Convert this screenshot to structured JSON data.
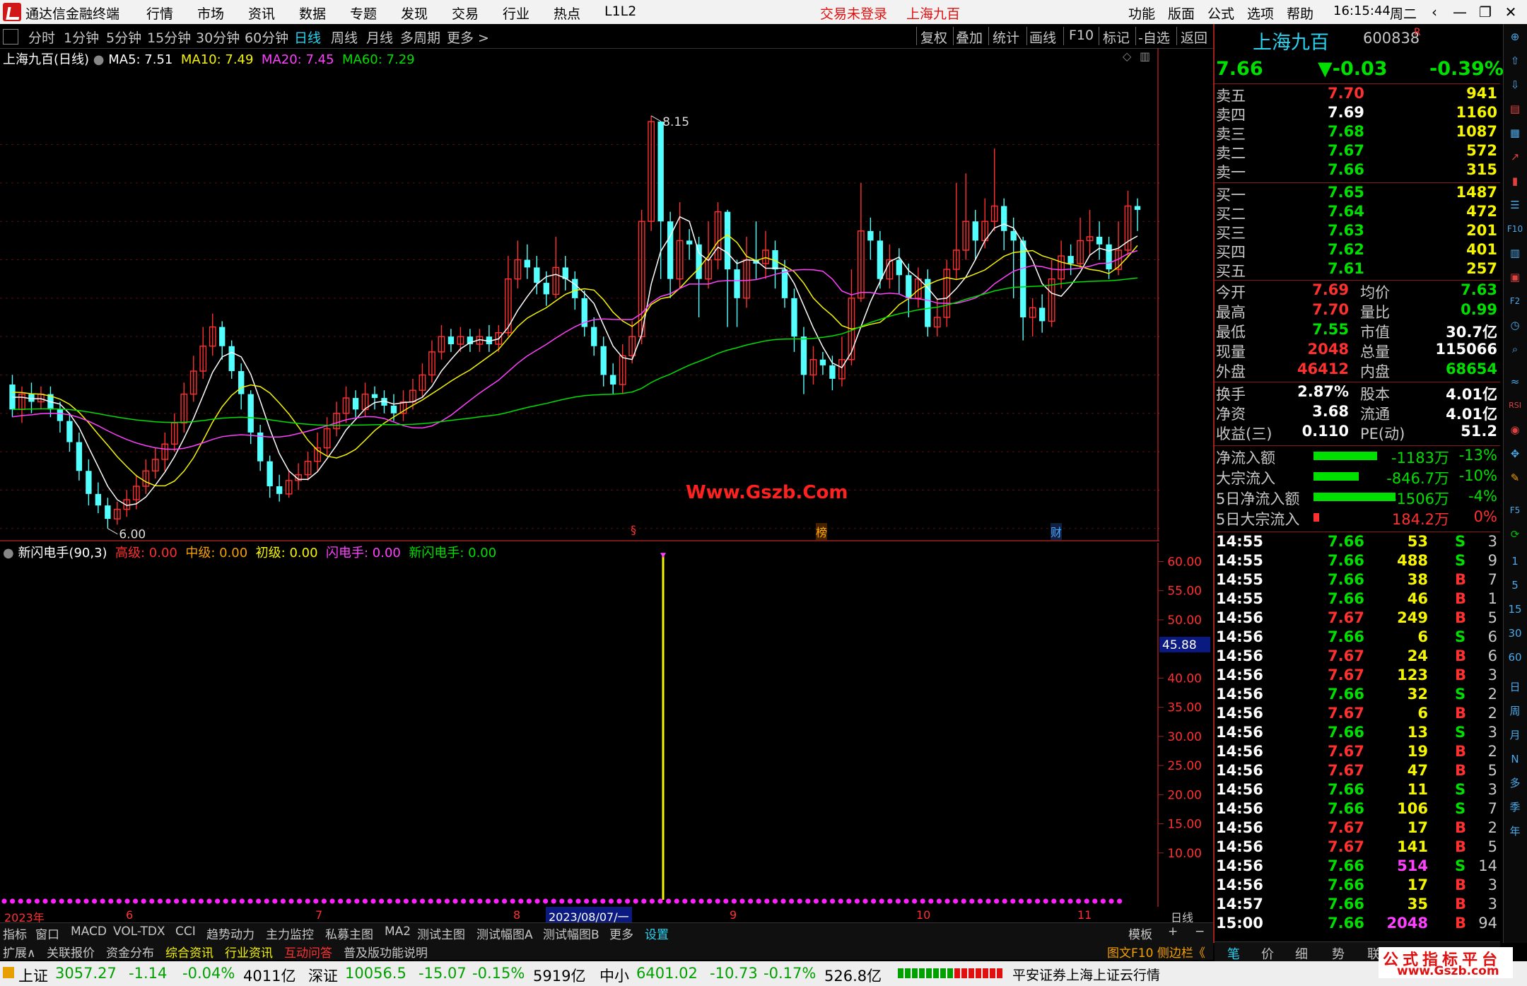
{
  "app": {
    "title": "通达信金融终端",
    "menu": [
      "行情",
      "市场",
      "资讯",
      "数据",
      "专题",
      "发现",
      "交易",
      "行业",
      "热点",
      "L1L2"
    ],
    "login_status": "交易未登录",
    "stock_name_title": "上海九百",
    "right_menu": [
      "功能",
      "版面",
      "公式",
      "选项",
      "帮助"
    ],
    "clock": "16:15:44",
    "weekday": "周二"
  },
  "toolbar": {
    "periods": [
      "分时",
      "1分钟",
      "5分钟",
      "15分钟",
      "30分钟",
      "60分钟",
      "日线",
      "周线",
      "月线",
      "多周期",
      "更多 >"
    ],
    "active_period": "日线",
    "actions": [
      "复权",
      "叠加",
      "统计",
      "画线",
      "F10",
      "标记",
      "-自选",
      "返回"
    ]
  },
  "main_chart": {
    "header_name": "上海九百(日线)",
    "ma": [
      {
        "label": "MA5: 7.51",
        "color": "#ffffff"
      },
      {
        "label": "MA10: 7.49",
        "color": "#f5f500"
      },
      {
        "label": "MA20: 7.45",
        "color": "#ff40ff"
      },
      {
        "label": "MA60: 7.29",
        "color": "#00e000"
      }
    ],
    "y_ticks": [
      "8.00",
      "7.80",
      "7.60",
      "7.40",
      "7.20",
      "7.00",
      "6.80",
      "6.60",
      "6.40",
      "6.20",
      "6.00"
    ],
    "high_label": "8.15",
    "low_label": "6.00",
    "watermark": "Www.Gszb.Com",
    "markers": [
      "§",
      "榜",
      "财"
    ]
  },
  "indicator": {
    "header": "新闪电手(90,3)",
    "items": [
      {
        "label": "高级: 0.00",
        "color": "#ff3030"
      },
      {
        "label": "中级: 0.00",
        "color": "#f5a000"
      },
      {
        "label": "初级: 0.00",
        "color": "#f5f500"
      },
      {
        "label": "闪电手: 0.00",
        "color": "#ff40ff"
      },
      {
        "label": "新闪电手: 0.00",
        "color": "#00e000"
      }
    ],
    "y_ticks": [
      "60.00",
      "55.00",
      "50.00",
      "40.00",
      "35.00",
      "30.00",
      "25.00",
      "20.00",
      "15.00",
      "10.00"
    ],
    "cursor_value": "45.88"
  },
  "x_axis": {
    "labels": [
      "2023年",
      "6",
      "7",
      "8",
      "9",
      "10",
      "11"
    ],
    "cursor_date": "2023/08/07/一",
    "period_label": "日线"
  },
  "tabs_row1": [
    "指标",
    "窗口",
    "MACD",
    "VOL-TDX",
    "CCI",
    "趋势动力",
    "主力监控",
    "私募主图",
    "MA2",
    "测试主图",
    "测试幅图A",
    "测试幅图B",
    "更多",
    "设置"
  ],
  "tabs_row1_right": [
    "模板",
    "+",
    "−"
  ],
  "tabs_row2": [
    "扩展∧",
    "关联报价",
    "资金分布",
    "综合资讯",
    "行业资讯",
    "互动问答",
    "普及版功能说明"
  ],
  "tabs_row2_right": "图文F10 侧边栏《",
  "quote": {
    "name": "上海九百",
    "code": "600838",
    "flag": "R",
    "price": "7.66",
    "change": "▼-0.03",
    "pct": "-0.39%",
    "asks": [
      {
        "label": "卖五",
        "price": "7.70",
        "vol": "941"
      },
      {
        "label": "卖四",
        "price": "7.69",
        "vol": "1160"
      },
      {
        "label": "卖三",
        "price": "7.68",
        "vol": "1087"
      },
      {
        "label": "卖二",
        "price": "7.67",
        "vol": "572"
      },
      {
        "label": "卖一",
        "price": "7.66",
        "vol": "315"
      }
    ],
    "bids": [
      {
        "label": "买一",
        "price": "7.65",
        "vol": "1487"
      },
      {
        "label": "买二",
        "price": "7.64",
        "vol": "472"
      },
      {
        "label": "买三",
        "price": "7.63",
        "vol": "201"
      },
      {
        "label": "买四",
        "price": "7.62",
        "vol": "401"
      },
      {
        "label": "买五",
        "price": "7.61",
        "vol": "257"
      }
    ],
    "stats": [
      {
        "l1": "今开",
        "v1": "7.69",
        "l2": "均价",
        "v2": "7.63"
      },
      {
        "l1": "最高",
        "v1": "7.70",
        "l2": "量比",
        "v2": "0.99"
      },
      {
        "l1": "最低",
        "v1": "7.55",
        "l2": "市值",
        "v2": "30.7亿"
      },
      {
        "l1": "现量",
        "v1": "2048",
        "l2": "总量",
        "v2": "115066"
      },
      {
        "l1": "外盘",
        "v1": "46412",
        "l2": "内盘",
        "v2": "68654"
      }
    ],
    "stats2": [
      {
        "l1": "换手",
        "v1": "2.87%",
        "l2": "股本",
        "v2": "4.01亿"
      },
      {
        "l1": "净资",
        "v1": "3.68",
        "l2": "流通",
        "v2": "4.01亿"
      },
      {
        "l1": "收益(三)",
        "v1": "0.110",
        "l2": "PE(动)",
        "v2": "51.2"
      }
    ],
    "flows": [
      {
        "label": "净流入额",
        "value": "-1183万",
        "pct": "-13%",
        "bar": 0.45,
        "color": "#00e000"
      },
      {
        "label": "大宗流入",
        "value": "-846.7万",
        "pct": "-10%",
        "bar": 0.32,
        "color": "#00e000"
      },
      {
        "label": "5日净流入额",
        "value": "-1506万",
        "pct": "-4%",
        "bar": 0.58,
        "color": "#00e000"
      },
      {
        "label": "5日大宗流入",
        "value": "184.2万",
        "pct": "0%",
        "bar": 0.04,
        "color": "#ff3030"
      }
    ]
  },
  "ticks": [
    {
      "t": "14:55",
      "p": "7.66",
      "v": "53",
      "s": "S",
      "n": "3"
    },
    {
      "t": "14:55",
      "p": "7.66",
      "v": "488",
      "s": "S",
      "n": "9"
    },
    {
      "t": "14:55",
      "p": "7.66",
      "v": "38",
      "s": "B",
      "n": "7"
    },
    {
      "t": "14:55",
      "p": "7.66",
      "v": "46",
      "s": "B",
      "n": "1"
    },
    {
      "t": "14:56",
      "p": "7.67",
      "v": "249",
      "s": "B",
      "n": "5"
    },
    {
      "t": "14:56",
      "p": "7.66",
      "v": "6",
      "s": "S",
      "n": "6"
    },
    {
      "t": "14:56",
      "p": "7.67",
      "v": "24",
      "s": "B",
      "n": "6"
    },
    {
      "t": "14:56",
      "p": "7.67",
      "v": "123",
      "s": "B",
      "n": "3"
    },
    {
      "t": "14:56",
      "p": "7.66",
      "v": "32",
      "s": "S",
      "n": "2"
    },
    {
      "t": "14:56",
      "p": "7.67",
      "v": "6",
      "s": "B",
      "n": "2"
    },
    {
      "t": "14:56",
      "p": "7.66",
      "v": "13",
      "s": "S",
      "n": "3"
    },
    {
      "t": "14:56",
      "p": "7.67",
      "v": "19",
      "s": "B",
      "n": "2"
    },
    {
      "t": "14:56",
      "p": "7.67",
      "v": "47",
      "s": "B",
      "n": "5"
    },
    {
      "t": "14:56",
      "p": "7.66",
      "v": "11",
      "s": "S",
      "n": "3"
    },
    {
      "t": "14:56",
      "p": "7.66",
      "v": "106",
      "s": "S",
      "n": "7"
    },
    {
      "t": "14:56",
      "p": "7.67",
      "v": "17",
      "s": "B",
      "n": "2"
    },
    {
      "t": "14:56",
      "p": "7.67",
      "v": "141",
      "s": "B",
      "n": "5"
    },
    {
      "t": "14:56",
      "p": "7.66",
      "v": "514",
      "s": "S",
      "n": "14"
    },
    {
      "t": "14:56",
      "p": "7.66",
      "v": "17",
      "s": "B",
      "n": "3"
    },
    {
      "t": "14:57",
      "p": "7.66",
      "v": "35",
      "s": "B",
      "n": "3"
    },
    {
      "t": "15:00",
      "p": "7.66",
      "v": "2048",
      "s": "B",
      "n": "94"
    }
  ],
  "panel_tabs": [
    "笔",
    "价",
    "细",
    "势",
    "联"
  ],
  "sidebar_labels": [
    "1",
    "5",
    "15",
    "30",
    "60",
    "日",
    "周",
    "月",
    "N",
    "多",
    "季",
    "年"
  ],
  "status": {
    "indices": [
      {
        "name": "上证",
        "val": "3057.27",
        "chg": "-1.14",
        "pct": "-0.04%",
        "amt": "4011亿"
      },
      {
        "name": "深证",
        "val": "10056.5",
        "chg": "-15.07",
        "pct": "-0.15%",
        "amt": "5919亿"
      },
      {
        "name": "中小",
        "val": "6401.02",
        "chg": "-10.73",
        "pct": "-0.17%",
        "amt": "526.8亿"
      }
    ],
    "server": "平安证券上海上证云行情",
    "brand": "公式指标平台",
    "brand_url": "www.Gszb.com"
  },
  "colors": {
    "up": "#ff3030",
    "down": "#54ffff",
    "ma5": "#ffffff",
    "ma10": "#f5f500",
    "ma20": "#ff40ff",
    "ma60": "#00e000"
  },
  "chart_data": {
    "type": "candlestick",
    "period": "日线",
    "ylim": [
      6.0,
      8.15
    ],
    "ma_last": {
      "MA5": 7.51,
      "MA10": 7.49,
      "MA20": 7.45,
      "MA60": 7.29
    },
    "high": 8.15,
    "low": 6.0,
    "candles": [
      [
        6.75,
        6.62,
        6.8,
        6.58
      ],
      [
        6.62,
        6.7,
        6.74,
        6.55
      ],
      [
        6.7,
        6.66,
        6.76,
        6.6
      ],
      [
        6.66,
        6.7,
        6.74,
        6.62
      ],
      [
        6.7,
        6.62,
        6.74,
        6.58
      ],
      [
        6.62,
        6.56,
        6.66,
        6.5
      ],
      [
        6.56,
        6.45,
        6.6,
        6.4
      ],
      [
        6.45,
        6.3,
        6.5,
        6.25
      ],
      [
        6.3,
        6.18,
        6.36,
        6.12
      ],
      [
        6.18,
        6.12,
        6.24,
        6.08
      ],
      [
        6.12,
        6.05,
        6.16,
        6.0
      ],
      [
        6.05,
        6.1,
        6.14,
        6.02
      ],
      [
        6.1,
        6.15,
        6.2,
        6.06
      ],
      [
        6.15,
        6.22,
        6.28,
        6.1
      ],
      [
        6.22,
        6.3,
        6.36,
        6.18
      ],
      [
        6.3,
        6.36,
        6.42,
        6.26
      ],
      [
        6.36,
        6.44,
        6.5,
        6.3
      ],
      [
        6.44,
        6.55,
        6.6,
        6.4
      ],
      [
        6.55,
        6.7,
        6.76,
        6.5
      ],
      [
        6.7,
        6.82,
        6.9,
        6.66
      ],
      [
        6.82,
        6.95,
        7.05,
        6.78
      ],
      [
        6.95,
        7.05,
        7.12,
        6.9
      ],
      [
        7.05,
        6.95,
        7.08,
        6.88
      ],
      [
        6.95,
        6.82,
        6.98,
        6.78
      ],
      [
        6.82,
        6.7,
        6.86,
        6.62
      ],
      [
        6.7,
        6.5,
        6.72,
        6.44
      ],
      [
        6.5,
        6.35,
        6.54,
        6.3
      ],
      [
        6.35,
        6.22,
        6.38,
        6.16
      ],
      [
        6.22,
        6.18,
        6.28,
        6.14
      ],
      [
        6.18,
        6.25,
        6.3,
        6.16
      ],
      [
        6.25,
        6.28,
        6.34,
        6.2
      ],
      [
        6.28,
        6.35,
        6.4,
        6.25
      ],
      [
        6.35,
        6.42,
        6.5,
        6.3
      ],
      [
        6.42,
        6.52,
        6.58,
        6.38
      ],
      [
        6.52,
        6.6,
        6.66,
        6.48
      ],
      [
        6.6,
        6.68,
        6.74,
        6.55
      ],
      [
        6.68,
        6.62,
        6.72,
        6.58
      ],
      [
        6.62,
        6.7,
        6.76,
        6.58
      ],
      [
        6.7,
        6.68,
        6.74,
        6.62
      ],
      [
        6.68,
        6.64,
        6.72,
        6.6
      ],
      [
        6.64,
        6.6,
        6.7,
        6.56
      ],
      [
        6.6,
        6.66,
        6.72,
        6.56
      ],
      [
        6.66,
        6.72,
        6.78,
        6.62
      ],
      [
        6.72,
        6.8,
        6.86,
        6.68
      ],
      [
        6.8,
        6.92,
        6.98,
        6.76
      ],
      [
        6.92,
        7.0,
        7.06,
        6.88
      ],
      [
        7.0,
        6.96,
        7.04,
        6.92
      ],
      [
        6.96,
        7.0,
        7.05,
        6.92
      ],
      [
        7.0,
        6.96,
        7.04,
        6.92
      ],
      [
        6.96,
        7.0,
        7.04,
        6.92
      ],
      [
        7.0,
        6.96,
        7.06,
        6.92
      ],
      [
        6.96,
        7.02,
        7.06,
        6.92
      ],
      [
        7.02,
        7.3,
        7.42,
        7.0
      ],
      [
        7.3,
        7.4,
        7.5,
        7.25
      ],
      [
        7.4,
        7.36,
        7.48,
        7.3
      ],
      [
        7.36,
        7.28,
        7.42,
        7.22
      ],
      [
        7.28,
        7.22,
        7.34,
        7.16
      ],
      [
        7.22,
        7.36,
        7.52,
        7.2
      ],
      [
        7.36,
        7.3,
        7.42,
        7.24
      ],
      [
        7.3,
        7.2,
        7.34,
        7.14
      ],
      [
        7.2,
        7.05,
        7.24,
        7.0
      ],
      [
        7.05,
        6.95,
        7.1,
        6.9
      ],
      [
        6.95,
        6.8,
        7.0,
        6.74
      ],
      [
        6.8,
        6.75,
        6.86,
        6.7
      ],
      [
        6.75,
        6.9,
        6.96,
        6.7
      ],
      [
        6.9,
        7.0,
        7.08,
        6.86
      ],
      [
        7.0,
        7.6,
        7.66,
        6.96
      ],
      [
        7.6,
        8.12,
        8.15,
        7.55
      ],
      [
        8.12,
        7.6,
        8.12,
        7.3
      ],
      [
        7.6,
        7.3,
        7.65,
        7.2
      ],
      [
        7.3,
        7.5,
        7.7,
        7.25
      ],
      [
        7.5,
        7.48,
        7.56,
        7.4
      ],
      [
        7.48,
        7.3,
        7.52,
        7.1
      ],
      [
        7.3,
        7.4,
        7.6,
        7.25
      ],
      [
        7.4,
        7.65,
        7.7,
        7.35
      ],
      [
        7.65,
        7.35,
        7.66,
        7.05
      ],
      [
        7.35,
        7.2,
        7.4,
        7.05
      ],
      [
        7.2,
        7.4,
        7.52,
        7.15
      ],
      [
        7.4,
        7.38,
        7.6,
        7.3
      ],
      [
        7.38,
        7.45,
        7.55,
        7.3
      ],
      [
        7.45,
        7.35,
        7.5,
        7.25
      ],
      [
        7.35,
        7.2,
        7.4,
        7.15
      ],
      [
        7.2,
        7.0,
        7.25,
        6.92
      ],
      [
        7.0,
        6.8,
        7.05,
        6.7
      ],
      [
        6.8,
        6.88,
        6.95,
        6.75
      ],
      [
        6.88,
        6.85,
        6.92,
        6.8
      ],
      [
        6.85,
        6.78,
        6.9,
        6.72
      ],
      [
        6.78,
        6.88,
        7.0,
        6.74
      ],
      [
        6.88,
        7.2,
        7.35,
        6.85
      ],
      [
        7.2,
        7.55,
        7.8,
        7.18
      ],
      [
        7.55,
        7.5,
        7.62,
        7.4
      ],
      [
        7.5,
        7.3,
        7.55,
        7.25
      ],
      [
        7.3,
        7.4,
        7.48,
        7.25
      ],
      [
        7.4,
        7.32,
        7.46,
        7.22
      ],
      [
        7.32,
        7.2,
        7.38,
        7.1
      ],
      [
        7.2,
        7.3,
        7.36,
        7.15
      ],
      [
        7.3,
        7.05,
        7.35,
        7.0
      ],
      [
        7.05,
        7.1,
        7.2,
        7.0
      ],
      [
        7.1,
        7.35,
        7.4,
        7.05
      ],
      [
        7.35,
        7.45,
        7.8,
        7.3
      ],
      [
        7.45,
        7.6,
        7.85,
        7.4
      ],
      [
        7.6,
        7.5,
        7.66,
        7.4
      ],
      [
        7.5,
        7.6,
        7.72,
        7.46
      ],
      [
        7.6,
        7.68,
        7.98,
        7.55
      ],
      [
        7.68,
        7.55,
        7.72,
        7.45
      ],
      [
        7.55,
        7.5,
        7.62,
        7.2
      ],
      [
        7.5,
        7.1,
        7.52,
        6.98
      ],
      [
        7.1,
        7.15,
        7.2,
        7.0
      ],
      [
        7.15,
        7.08,
        7.22,
        7.02
      ],
      [
        7.08,
        7.3,
        7.4,
        7.05
      ],
      [
        7.3,
        7.42,
        7.5,
        7.25
      ],
      [
        7.42,
        7.38,
        7.48,
        7.32
      ],
      [
        7.38,
        7.5,
        7.62,
        7.36
      ],
      [
        7.5,
        7.52,
        7.66,
        7.42
      ],
      [
        7.52,
        7.48,
        7.6,
        7.4
      ],
      [
        7.48,
        7.35,
        7.52,
        7.3
      ],
      [
        7.35,
        7.45,
        7.6,
        7.32
      ],
      [
        7.45,
        7.68,
        7.76,
        7.42
      ],
      [
        7.68,
        7.66,
        7.72,
        7.55
      ]
    ]
  }
}
